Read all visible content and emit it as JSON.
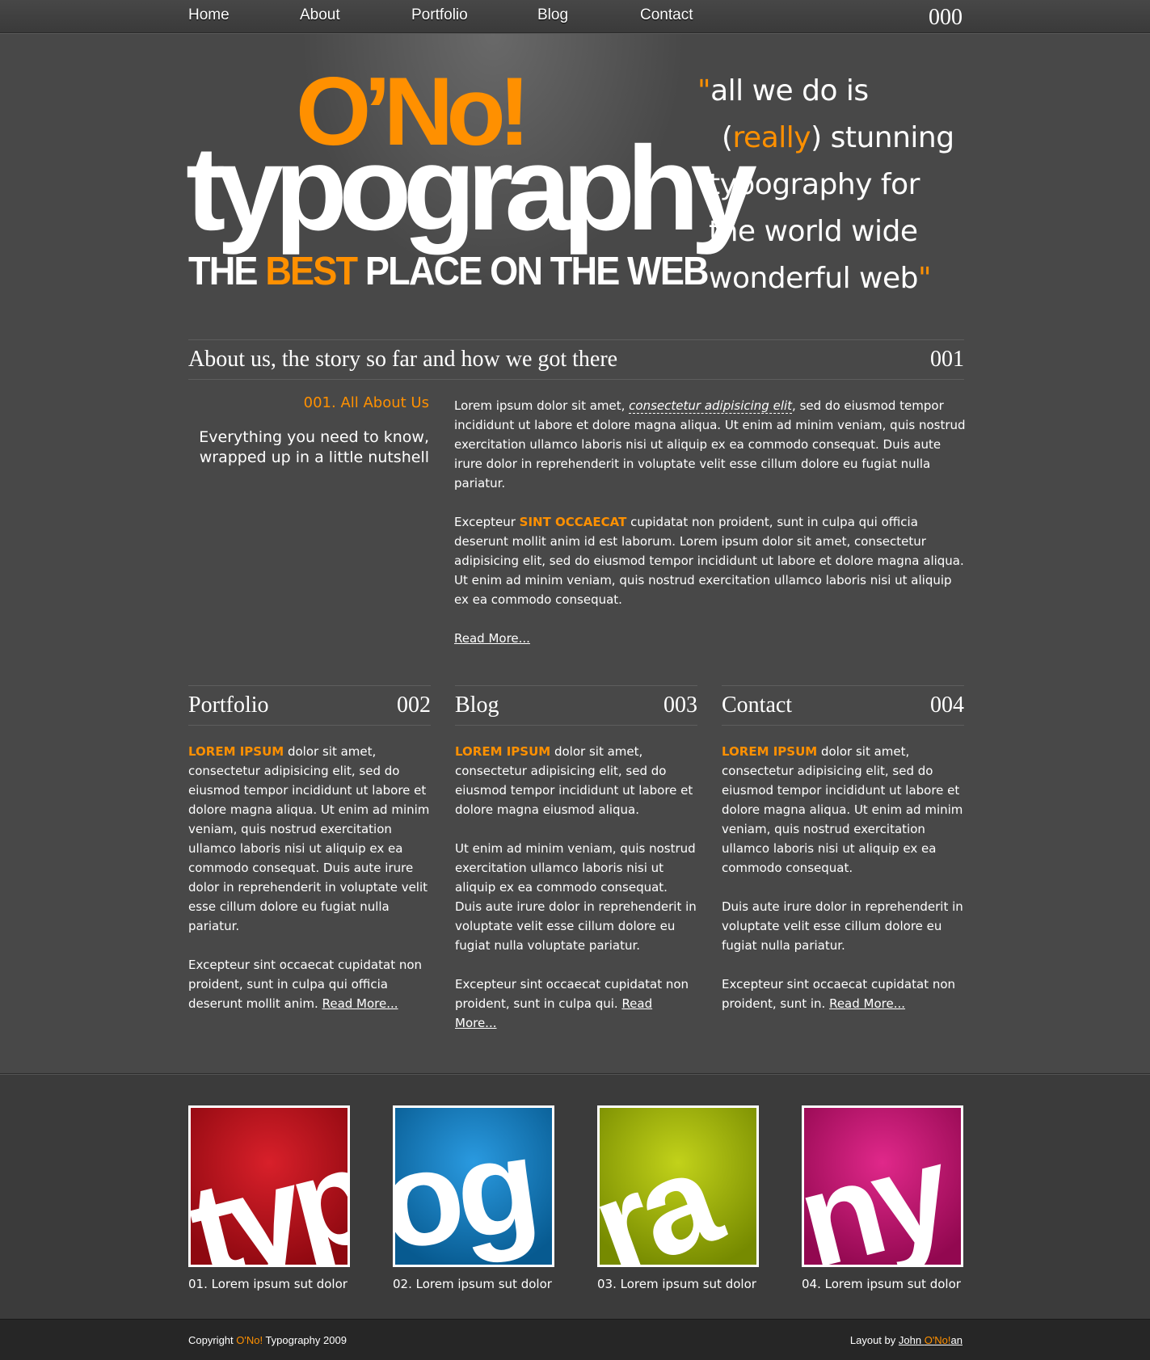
{
  "nav": {
    "items": [
      "Home",
      "About",
      "Portfolio",
      "Blog",
      "Contact"
    ],
    "number": "000"
  },
  "hero": {
    "brand": "O’No!",
    "word": "typography",
    "tag_before": "THE ",
    "tag_highlight": "BEST",
    "tag_after": " PLACE ON THE WEB",
    "quote": {
      "open": "\"",
      "l1": "all we do is",
      "l2_open": "(",
      "l2_highlight": "really",
      "l2_close": ") stunning",
      "l3": "typography for",
      "l4": "the world wide",
      "l5": "wonderful web",
      "close": "\""
    }
  },
  "about": {
    "header": "About us, the story so far and how we got there",
    "number": "001",
    "kicker": "001. All About Us",
    "lead": "Everything you need to know, wrapped up in a little nutshell",
    "p1_before": "Lorem ipsum dolor sit amet, ",
    "p1_em": "consectetur adipisicing elit",
    "p1_after": ", sed do eiusmod tempor incididunt ut labore et dolore magna aliqua. Ut enim ad minim veniam, quis nostrud exercitation ullamco laboris nisi ut aliquip ex ea commodo consequat. Duis aute irure dolor in reprehenderit in voluptate velit esse cillum dolore eu fugiat nulla pariatur.",
    "p2_before": "Excepteur ",
    "p2_caps": "SINT OCCAECAT",
    "p2_after": " cupidatat non proident, sunt in culpa qui officia deserunt mollit anim id est laborum. Lorem ipsum dolor sit amet, consectetur adipisicing elit, sed do eiusmod tempor incididunt ut labore et dolore magna aliqua. Ut enim ad minim veniam, quis nostrud exercitation ullamco laboris nisi ut aliquip ex ea commodo consequat.",
    "read_more": "Read More..."
  },
  "columns": [
    {
      "title": "Portfolio",
      "number": "002",
      "caps": "LOREM IPSUM",
      "p1": " dolor sit amet, consectetur adipisicing elit, sed do eiusmod tempor incididunt ut labore et dolore magna aliqua. Ut enim ad minim veniam, quis nostrud exercitation ullamco laboris nisi ut aliquip ex ea commodo consequat. Duis aute irure dolor in reprehenderit in voluptate velit esse cillum dolore eu fugiat nulla pariatur.",
      "p2": "Excepteur sint occaecat cupidatat non proident, sunt in culpa qui officia deserunt mollit anim. ",
      "read_more": "Read More..."
    },
    {
      "title": "Blog",
      "number": "003",
      "caps": "LOREM IPSUM",
      "p1": " dolor sit amet, consectetur adipisicing elit, sed do eiusmod tempor incididunt ut labore et dolore magna eiusmod aliqua.",
      "p2": "Ut enim ad minim veniam, quis nostrud exercitation ullamco laboris nisi ut aliquip ex ea commodo consequat. Duis aute irure dolor in reprehenderit in voluptate velit esse cillum dolore eu fugiat nulla voluptate pariatur.",
      "p3": "Excepteur sint occaecat cupidatat non proident, sunt in culpa qui. ",
      "read_more": "Read More..."
    },
    {
      "title": "Contact",
      "number": "004",
      "caps": "LOREM IPSUM",
      "p1": " dolor sit amet, consectetur adipisicing elit, sed do eiusmod tempor incididunt ut labore et dolore magna aliqua. Ut enim ad minim veniam, quis nostrud exercitation ullamco laboris nisi ut aliquip ex ea commodo consequat.",
      "p2": "Duis aute irure dolor in reprehenderit in voluptate velit esse cillum dolore eu fugiat nulla pariatur.",
      "p3": "Excepteur sint occaecat cupidatat non proident, sunt in. ",
      "read_more": "Read More..."
    }
  ],
  "gallery": [
    {
      "letters": "typ",
      "caption": "01. Lorem ipsum sut dolor",
      "color": "#b0101a"
    },
    {
      "letters": "og",
      "caption": "02. Lorem ipsum sut dolor",
      "color": "#0f78b8"
    },
    {
      "letters": "ra",
      "caption": "03. Lorem ipsum sut dolor",
      "color": "#9db000"
    },
    {
      "letters": "ny",
      "caption": "04. Lorem ipsum sut dolor",
      "color": "#c0106e"
    }
  ],
  "footer": {
    "copy_before": "Copyright ",
    "copy_brand": "O'No!",
    "copy_after": " Typography 2009",
    "layout_by": "Layout by ",
    "author_first": "John ",
    "author_mid": "O'No!",
    "author_last": "an"
  },
  "colors": {
    "accent": "#ff9000",
    "background": "#484848"
  }
}
